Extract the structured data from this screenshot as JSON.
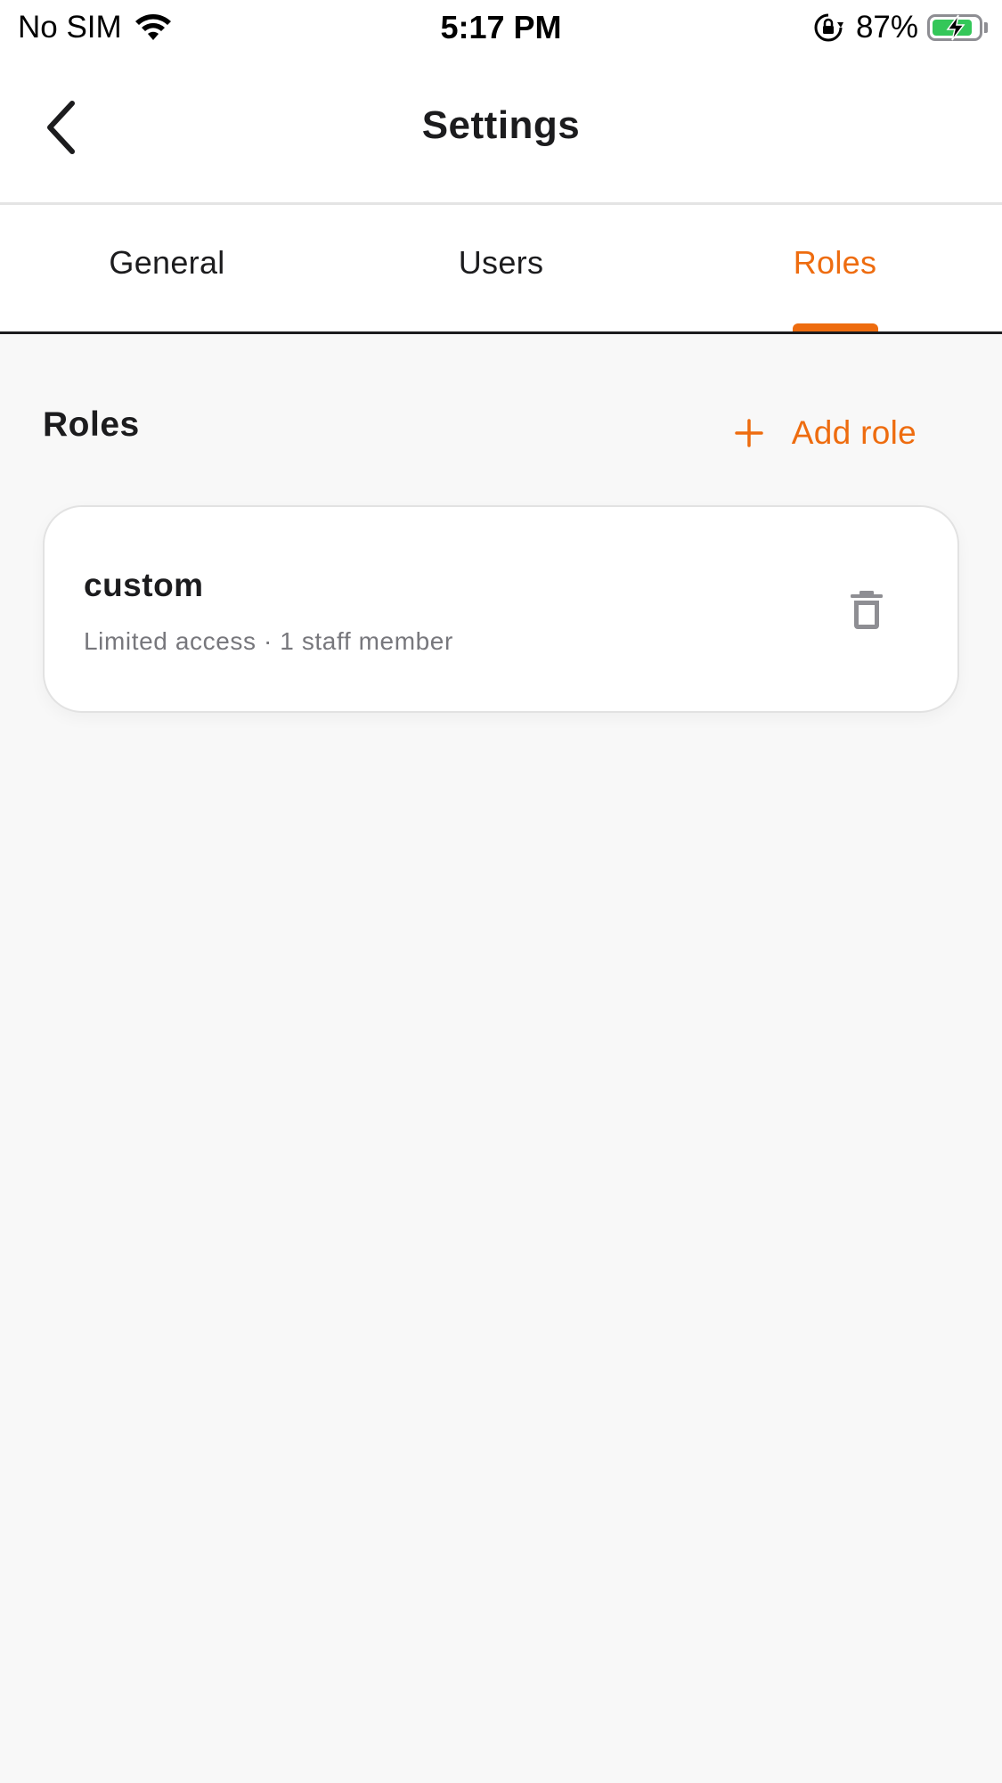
{
  "status_bar": {
    "carrier": "No SIM",
    "time": "5:17 PM",
    "battery_percent": "87%",
    "battery_level": 0.87,
    "battery_color": "#34c759"
  },
  "header": {
    "title": "Settings",
    "back_icon": "chevron-left-icon"
  },
  "tabs": [
    {
      "label": "General",
      "active": false
    },
    {
      "label": "Users",
      "active": false
    },
    {
      "label": "Roles",
      "active": true
    }
  ],
  "roles_section": {
    "heading": "Roles",
    "add_button_label": "Add role",
    "add_icon": "plus-icon",
    "items": [
      {
        "name": "custom",
        "description": "Limited access · 1 staff member",
        "delete_icon": "trash-icon"
      }
    ]
  },
  "colors": {
    "accent": "#ee6c0f",
    "text_primary": "#1c1c1e",
    "text_secondary": "#77777c",
    "background": "#f8f8f8",
    "surface": "#ffffff"
  }
}
